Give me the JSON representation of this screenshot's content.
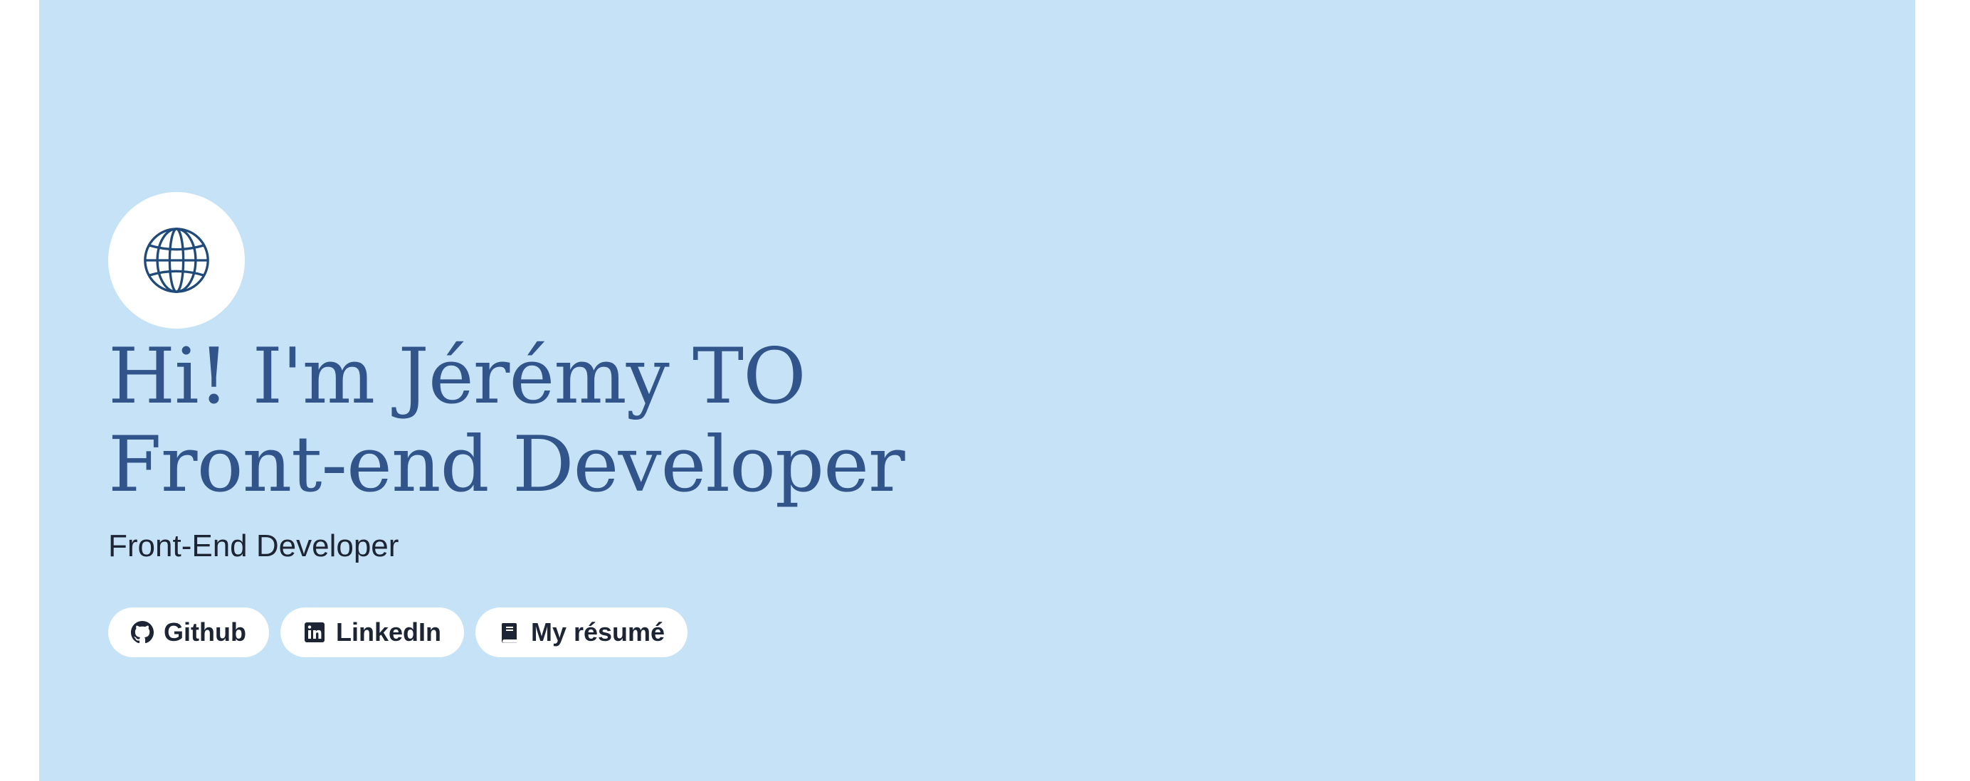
{
  "hero": {
    "avatar_icon": "globe-icon",
    "headline_line1": "Hi! I'm Jérémy TO",
    "headline_line2": "Front-end Developer",
    "subtitle": "Front-End Developer",
    "accent_color": "#31548a",
    "background_color": "#c6e2f6"
  },
  "links": [
    {
      "label": "Github",
      "icon": "github-icon"
    },
    {
      "label": "LinkedIn",
      "icon": "linkedin-icon"
    },
    {
      "label": "My résumé",
      "icon": "book-icon"
    }
  ]
}
